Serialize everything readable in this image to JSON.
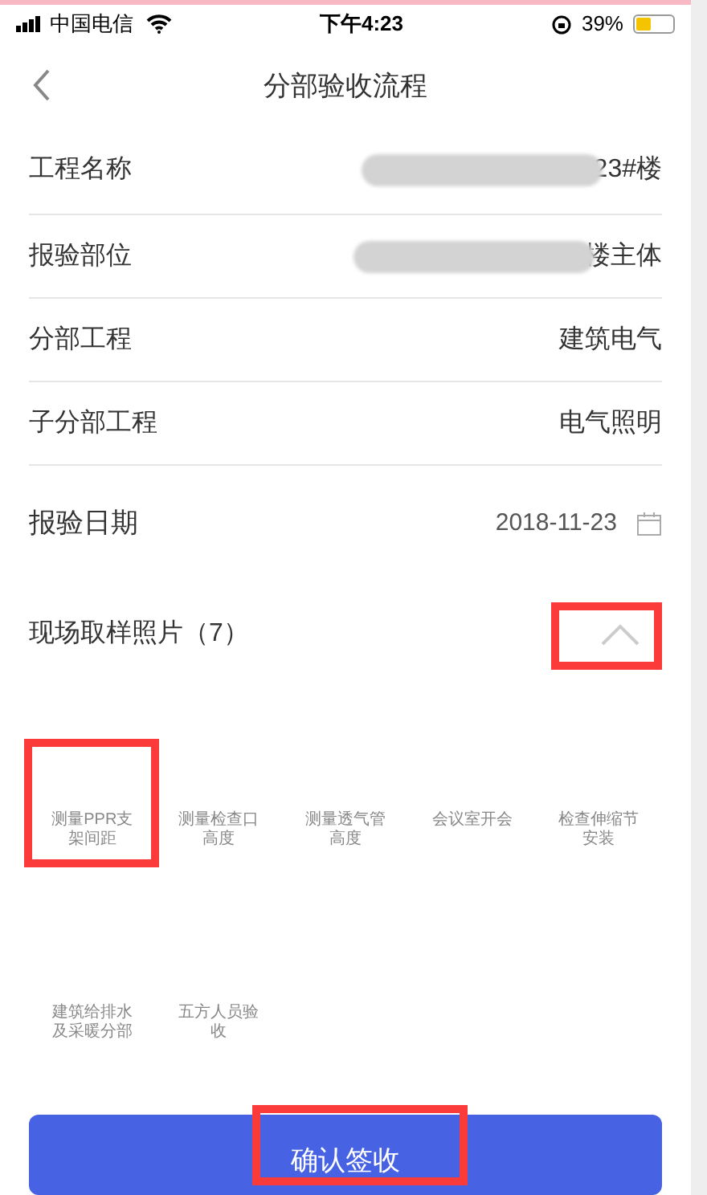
{
  "status_bar": {
    "carrier": "中国电信",
    "time": "下午4:23",
    "battery": "39%"
  },
  "header": {
    "title": "分部验收流程"
  },
  "fields": [
    {
      "kind": "text",
      "label": "工程名称",
      "value": "23#楼",
      "redacted": true
    },
    {
      "kind": "text",
      "label": "报验部位",
      "value": "楼主体",
      "redacted": true
    },
    {
      "kind": "text",
      "label": "分部工程",
      "value": "建筑电气",
      "redacted": false
    },
    {
      "kind": "text",
      "label": "子分部工程",
      "value": "电气照明",
      "redacted": false
    },
    {
      "kind": "date",
      "label": "报验日期",
      "value": "2018-11-23",
      "redacted": false
    }
  ],
  "photos": {
    "title": "现场取样照片（7）",
    "expanded": true,
    "highlighted_toggle": true,
    "items": [
      {
        "caption": "测量PPR支架间距",
        "highlighted": true
      },
      {
        "caption": "测量检查口高度",
        "highlighted": false
      },
      {
        "caption": "测量透气管高度",
        "highlighted": false
      },
      {
        "caption": "会议室开会",
        "highlighted": false
      },
      {
        "caption": "检查伸缩节安装",
        "highlighted": false
      },
      {
        "caption": "建筑给排水及采暖分部",
        "highlighted": false
      },
      {
        "caption": "五方人员验收",
        "highlighted": false
      }
    ]
  },
  "confirm": {
    "label": "确认签收",
    "highlighted": true
  }
}
